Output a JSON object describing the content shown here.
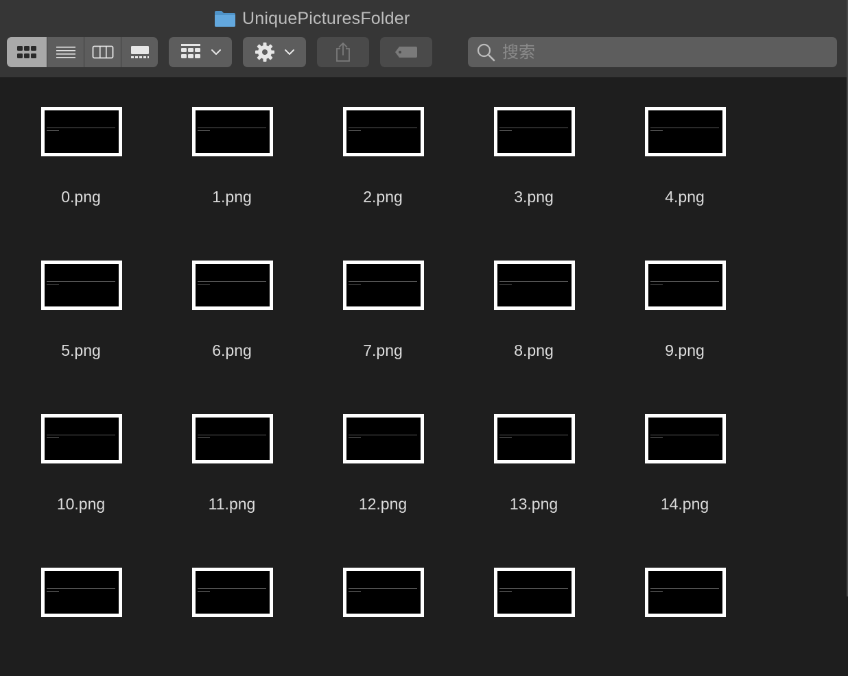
{
  "window": {
    "title": "UniquePicturesFolder",
    "folder_icon": "folder-icon",
    "folder_color": "#63a8de"
  },
  "toolbar": {
    "view_modes": [
      {
        "name": "icon-view",
        "icon": "grid-icon",
        "active": true
      },
      {
        "name": "list-view",
        "icon": "list-icon",
        "active": false
      },
      {
        "name": "column-view",
        "icon": "columns-icon",
        "active": false
      },
      {
        "name": "gallery-view",
        "icon": "gallery-icon",
        "active": false
      }
    ],
    "group_by_icon": "group-grid-icon",
    "action_icon": "gear-icon",
    "share_icon": "share-icon",
    "tag_icon": "tag-icon"
  },
  "search": {
    "placeholder": "搜索",
    "value": ""
  },
  "files": [
    {
      "name": "0.png"
    },
    {
      "name": "1.png"
    },
    {
      "name": "2.png"
    },
    {
      "name": "3.png"
    },
    {
      "name": "4.png"
    },
    {
      "name": "5.png"
    },
    {
      "name": "6.png"
    },
    {
      "name": "7.png"
    },
    {
      "name": "8.png"
    },
    {
      "name": "9.png"
    },
    {
      "name": "10.png"
    },
    {
      "name": "11.png"
    },
    {
      "name": "12.png"
    },
    {
      "name": "13.png"
    },
    {
      "name": "14.png"
    },
    {
      "name": ""
    },
    {
      "name": ""
    },
    {
      "name": ""
    },
    {
      "name": ""
    },
    {
      "name": ""
    }
  ],
  "colors": {
    "background": "#1e1e1e",
    "toolbar": "#363636",
    "button": "#5d5d5d",
    "active_segment": "#a9a9a9",
    "label_text": "#dcdcdc"
  }
}
